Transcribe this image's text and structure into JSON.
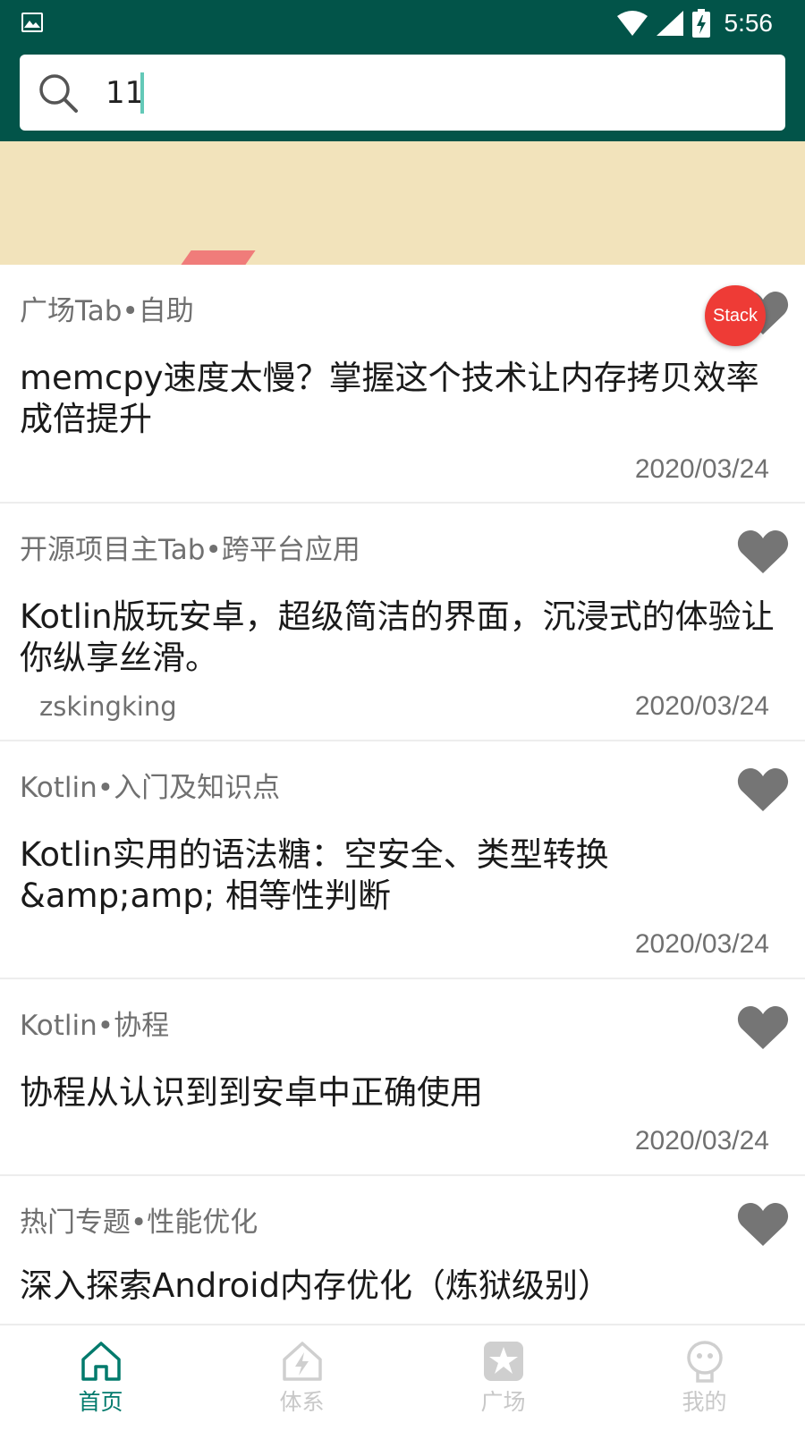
{
  "status_bar": {
    "time": "5:56",
    "icons": [
      "image-notification-icon",
      "wifi-icon",
      "cell-signal-icon",
      "battery-charging-icon"
    ]
  },
  "search": {
    "value": "11",
    "icon": "search-icon"
  },
  "colors": {
    "header": "#025449",
    "banner": "#f2e3bb",
    "accent": "#017a6c",
    "fab": "#ee3b36",
    "heart": "#757575"
  },
  "fab": {
    "label": "Stack"
  },
  "articles": [
    {
      "chapter": "广场Tab•自助",
      "title": "memcpy速度太慢？掌握这个技术让内存拷贝效率成倍提升",
      "author": "",
      "date": "2020/03/24"
    },
    {
      "chapter": "开源项目主Tab•跨平台应用",
      "title": "Kotlin版玩安卓，超级简洁的界面，沉浸式的体验让你纵享丝滑。",
      "author": "zskingking",
      "date": "2020/03/24"
    },
    {
      "chapter": "Kotlin•入门及知识点",
      "title": "Kotlin实用的语法糖：空安全、类型转换 &amp;amp; 相等性判断",
      "author": "",
      "date": "2020/03/24"
    },
    {
      "chapter": "Kotlin•协程",
      "title": "协程从认识到到安卓中正确使用",
      "author": "",
      "date": "2020/03/24"
    },
    {
      "chapter": "热门专题•性能优化",
      "title": "深入探索Android内存优化（炼狱级别）",
      "author": "",
      "date": ""
    }
  ],
  "bottom_nav": [
    {
      "label": "首页",
      "icon": "home-icon",
      "active": true
    },
    {
      "label": "体系",
      "icon": "system-icon",
      "active": false
    },
    {
      "label": "广场",
      "icon": "square-icon",
      "active": false
    },
    {
      "label": "我的",
      "icon": "profile-icon",
      "active": false
    }
  ]
}
